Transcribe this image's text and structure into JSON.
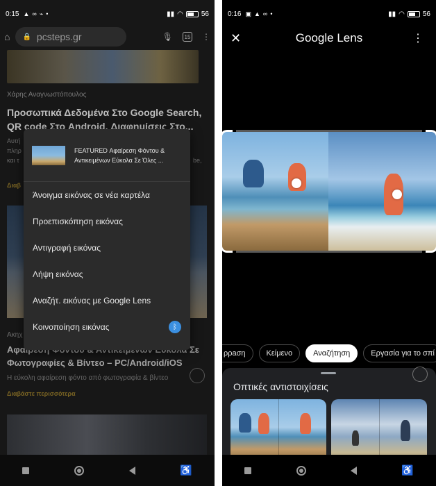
{
  "left": {
    "status": {
      "time": "0:15",
      "battery": "56"
    },
    "browser": {
      "url": "pcsteps.gr",
      "tab_count": "15"
    },
    "article1": {
      "author": "Χάρης Αναγνωστόπουλος",
      "title": "Προσωπικά Δεδομένα Στο Google Search, QR code Στο Android, Διαφημίσεις Στο...",
      "peek1": "Αυτή",
      "peek2": "πληρ",
      "peek3": "και τ",
      "peek_right": "be,",
      "peek_link": "Διαβ"
    },
    "article2": {
      "peek": "Ακηχ",
      "title": "Αφαίρεση Φόντου & Αντικειμένων Εύκολα Σε Φωτογραφίες & Βίντεο – PC/Android/iOS",
      "desc": "Η εύκολη αφαίρεση φόντο από φωτογραφία & βίντεο",
      "more": "Διαβάστε περισσότερα"
    },
    "context_menu": {
      "header_title": "FEATURED Αφαίρεση Φόντου & Αντικειμένων Εύκολα Σε Όλες ...",
      "items": [
        "Άνοιγμα εικόνας σε νέα καρτέλα",
        "Προεπισκόπηση εικόνας",
        "Αντιγραφή εικόνας",
        "Λήψη εικόνας",
        "Αναζήτ. εικόνας με Google Lens",
        "Κοινοποίηση εικόνας"
      ]
    }
  },
  "right": {
    "status": {
      "time": "0:16",
      "battery": "56"
    },
    "header": {
      "title": "Google Lens"
    },
    "chips": [
      "ρρaση",
      "Κείμενο",
      "Αναζήτηση",
      "Εργασία για το σπί"
    ],
    "active_chip": "Αναζήτηση",
    "sheet": {
      "title": "Οπτικές αντιστοιχίσεις"
    }
  },
  "colors": {
    "accent_blue": "#3b8fe0",
    "link_gold": "#7a6423",
    "sheet_bg": "#202124"
  }
}
